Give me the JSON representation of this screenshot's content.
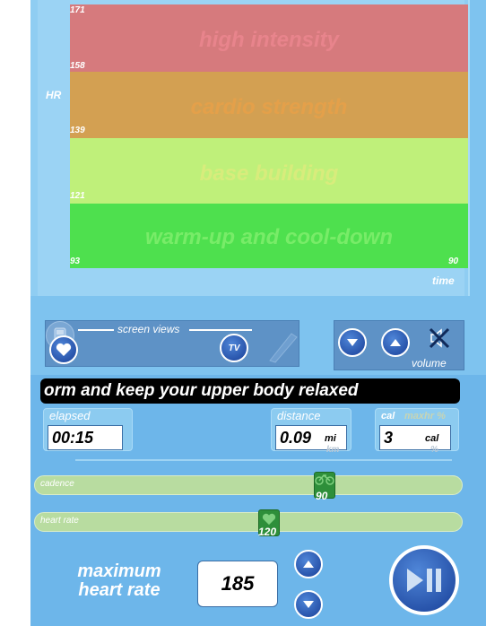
{
  "chart": {
    "zones": [
      {
        "label": "high intensity",
        "color": "#d67a7d"
      },
      {
        "label": "cardio strength",
        "color": "#d3a052"
      },
      {
        "label": "base building",
        "color": "#bff07a"
      },
      {
        "label": "warm-up and cool-down",
        "color": "#4ee04e"
      }
    ],
    "y_ticks": [
      "171",
      "158",
      "139",
      "121",
      "93"
    ],
    "x_tick_end": "90",
    "y_axis_label": "HR",
    "x_axis_label": "time"
  },
  "screen_views": {
    "label": "screen views",
    "tv_label": "TV",
    "icons": [
      "heart-icon",
      "ipod-icon",
      "tv-icon",
      "remote-icon"
    ]
  },
  "volume": {
    "label": "volume",
    "icons": [
      "chevron-down-icon",
      "chevron-up-icon",
      "mute-icon"
    ]
  },
  "message": "orm and keep your upper body relaxed",
  "stats": {
    "elapsed": {
      "label": "elapsed",
      "value": "00:15"
    },
    "distance": {
      "label": "distance",
      "value": "0.09",
      "unit": "mi",
      "alt_unit": "km"
    },
    "cal": {
      "label": "cal",
      "alt_label": "maxhr %",
      "value": "3",
      "unit": "cal",
      "alt_unit": "%"
    }
  },
  "sliders": {
    "cadence": {
      "label": "cadence",
      "value": "90",
      "icon": "bike-icon"
    },
    "heart_rate": {
      "label": "heart rate",
      "value": "120",
      "icon": "heart-icon"
    }
  },
  "max_heart_rate": {
    "title": "maximum heart rate",
    "value": "185"
  },
  "colors": {
    "accent": "#2b5fba",
    "panel": "#7ec3ef",
    "message_bg": "#000000"
  }
}
